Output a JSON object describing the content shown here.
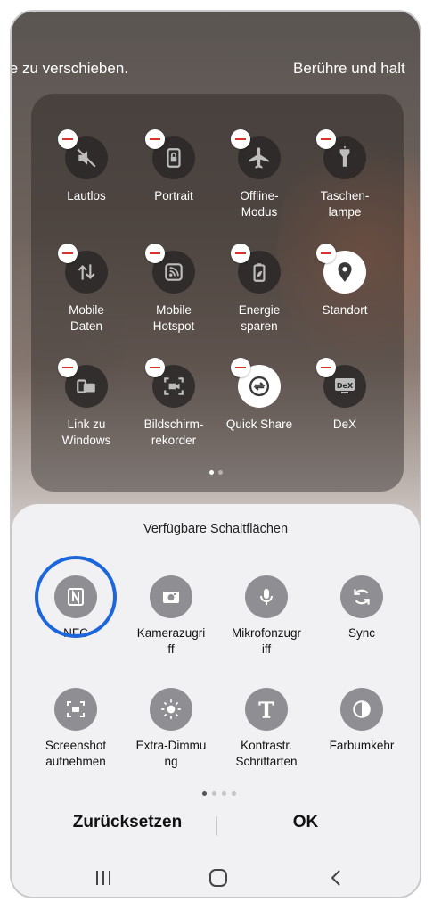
{
  "hints": {
    "left": "ie zu verschieben.",
    "right": "Berühre und halt"
  },
  "active_tiles": [
    {
      "label": "Lautlos",
      "icon": "mute-icon",
      "state": "off"
    },
    {
      "label": "Portrait",
      "icon": "portrait-lock-icon",
      "state": "off"
    },
    {
      "label": "Offline-\nModus",
      "icon": "airplane-icon",
      "state": "off"
    },
    {
      "label": "Taschen-\nlampe",
      "icon": "flashlight-icon",
      "state": "off"
    },
    {
      "label": "Mobile\nDaten",
      "icon": "mobile-data-icon",
      "state": "off"
    },
    {
      "label": "Mobile\nHotspot",
      "icon": "hotspot-icon",
      "state": "off"
    },
    {
      "label": "Energie\nsparen",
      "icon": "battery-leaf-icon",
      "state": "off"
    },
    {
      "label": "Standort",
      "icon": "location-pin-icon",
      "state": "on"
    },
    {
      "label": "Link zu\nWindows",
      "icon": "link-to-windows-icon",
      "state": "off"
    },
    {
      "label": "Bildschirm-\nrekorder",
      "icon": "screen-recorder-icon",
      "state": "off"
    },
    {
      "label": "Quick Share",
      "icon": "quick-share-icon",
      "state": "on"
    },
    {
      "label": "DeX",
      "icon": "dex-icon",
      "state": "off"
    }
  ],
  "panel_pages": {
    "count": 2,
    "current": 1
  },
  "sheet": {
    "title": "Verfügbare Schaltflächen",
    "buttons": [
      {
        "label": "NFC",
        "icon": "nfc-icon",
        "highlighted": true
      },
      {
        "label": "Kamerazugri\nff",
        "icon": "camera-icon"
      },
      {
        "label": "Mikrofonzugr\niff",
        "icon": "microphone-icon"
      },
      {
        "label": "Sync",
        "icon": "sync-icon"
      },
      {
        "label": "Screenshot\naufnehmen",
        "icon": "screenshot-icon"
      },
      {
        "label": "Extra-Dimmu\nng",
        "icon": "extra-dim-icon"
      },
      {
        "label": "Kontrastr.\nSchriftarten",
        "icon": "contrast-font-icon"
      },
      {
        "label": "Farbumkehr",
        "icon": "color-inversion-icon"
      }
    ],
    "pages": {
      "count": 4,
      "current": 1
    },
    "reset_label": "Zurücksetzen",
    "ok_label": "OK"
  },
  "navbar": {
    "recents": "recents-icon",
    "home": "home-icon",
    "back": "back-icon"
  },
  "colors": {
    "highlight_ring": "#1c66db",
    "remove_badge": "#d9342b",
    "sheet_icon_bg": "#8f8f93"
  }
}
